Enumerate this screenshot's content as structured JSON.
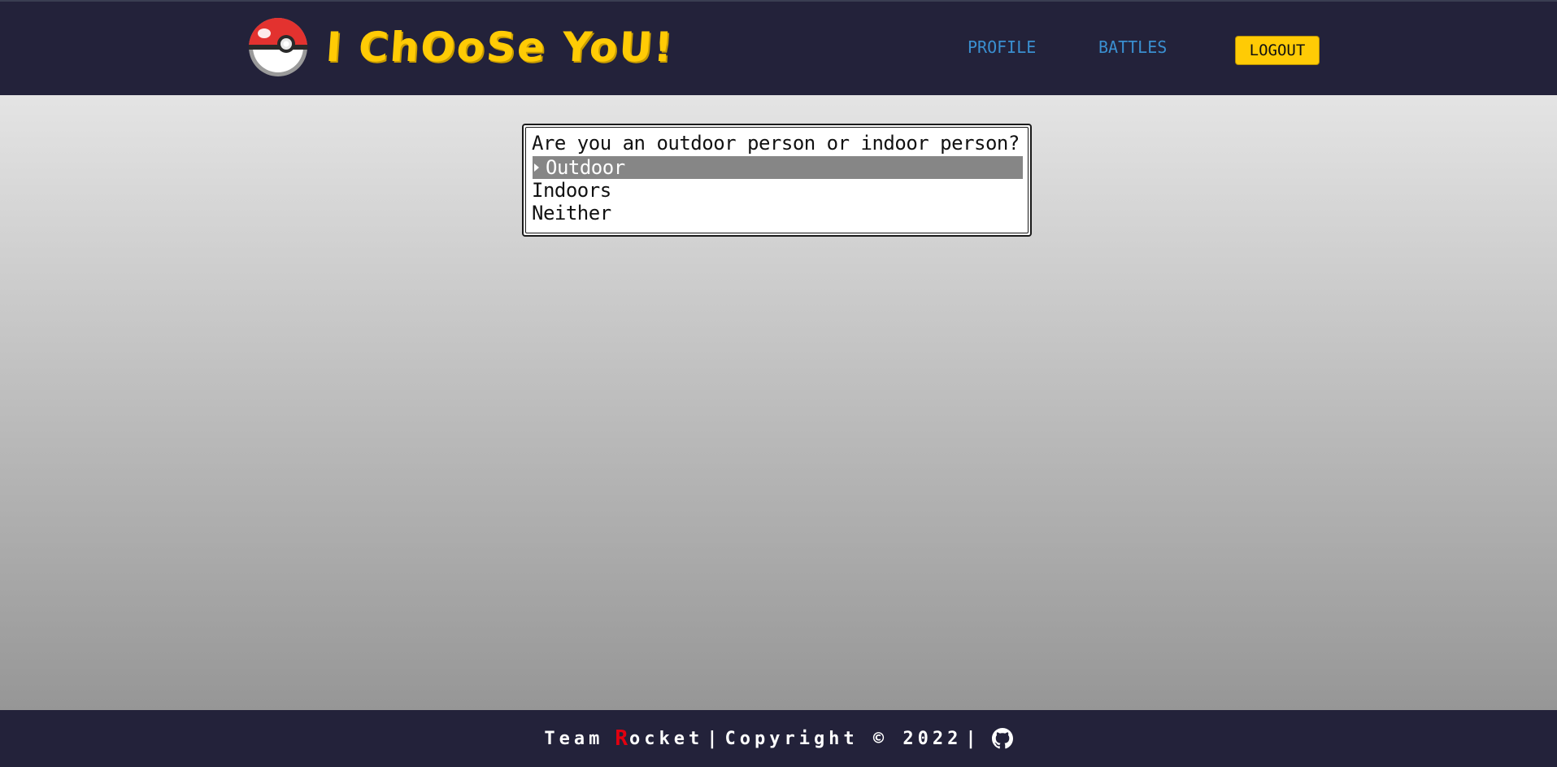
{
  "header": {
    "brand": "I ChOoSe YoU!",
    "nav": {
      "profile_label": "PROFILE",
      "battles_label": "BATTLES",
      "logout_label": "LOGOUT"
    },
    "colors": {
      "bar": "#23223a",
      "brand": "#ffcb05",
      "nav_link": "#3a8fd0",
      "logout_bg": "#ffcb05"
    }
  },
  "quiz": {
    "question": "Are you an outdoor person or indoor person?",
    "options": [
      {
        "label": "Outdoor",
        "selected": true
      },
      {
        "label": "Indoors",
        "selected": false
      },
      {
        "label": "Neither",
        "selected": false
      }
    ]
  },
  "footer": {
    "team_initial": "R",
    "team_prefix": "Team",
    "team_rest": "ocket",
    "separator": "|",
    "copyright": "Copyright © 2022",
    "icon": "github-icon",
    "colors": {
      "initial": "#e3000f"
    }
  }
}
